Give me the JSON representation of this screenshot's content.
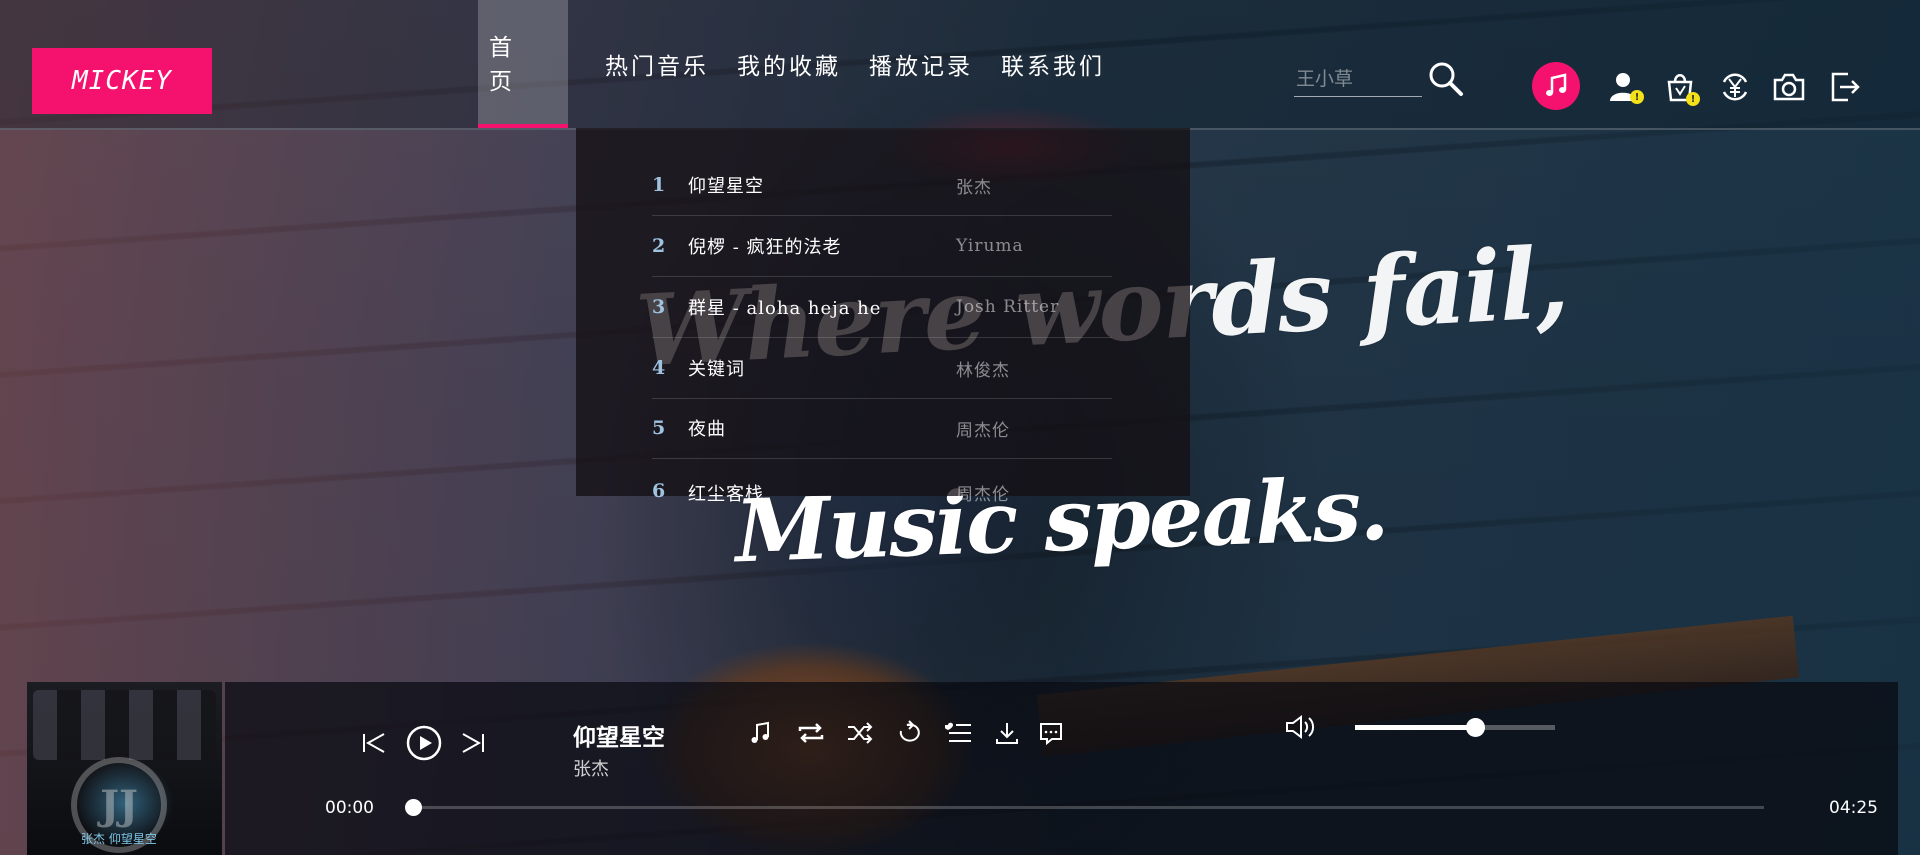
{
  "header": {
    "logo": "MICKEY",
    "nav": [
      {
        "label": "首 页",
        "active": true
      },
      {
        "label": "热门音乐",
        "active": false
      },
      {
        "label": "我的收藏",
        "active": false
      },
      {
        "label": "播放记录",
        "active": false
      },
      {
        "label": "联系我们",
        "active": false
      }
    ],
    "search": {
      "placeholder": "王小草",
      "value": ""
    },
    "icons": [
      "search-icon",
      "music-note-icon",
      "user-icon",
      "shopping-bag-icon",
      "yen-icon",
      "camera-icon",
      "logout-icon"
    ],
    "badges": {
      "user": "!",
      "bag": "!"
    }
  },
  "hero": {
    "line1": "Where words fail,",
    "line2": "Music speaks."
  },
  "dropdown": {
    "songs": [
      {
        "num": "1",
        "title": "仰望星空",
        "artist": "张杰"
      },
      {
        "num": "2",
        "title": "倪椤 - 疯狂的法老",
        "artist": "Yiruma"
      },
      {
        "num": "3",
        "title": "群星 - aloha heja he",
        "artist": "Josh Ritter"
      },
      {
        "num": "4",
        "title": "关键词",
        "artist": "林俊杰"
      },
      {
        "num": "5",
        "title": "夜曲",
        "artist": "周杰伦"
      },
      {
        "num": "6",
        "title": "红尘客栈",
        "artist": "周杰伦"
      }
    ]
  },
  "player": {
    "cover_caption": "张杰 仰望星空",
    "cover_logo": "JJ",
    "title": "仰望星空",
    "artist": "张杰",
    "time_current": "00:00",
    "time_total": "04:25",
    "progress": 0.0,
    "volume": 0.6
  },
  "colors": {
    "accent": "#f5116e",
    "badge": "#f5e11a"
  }
}
